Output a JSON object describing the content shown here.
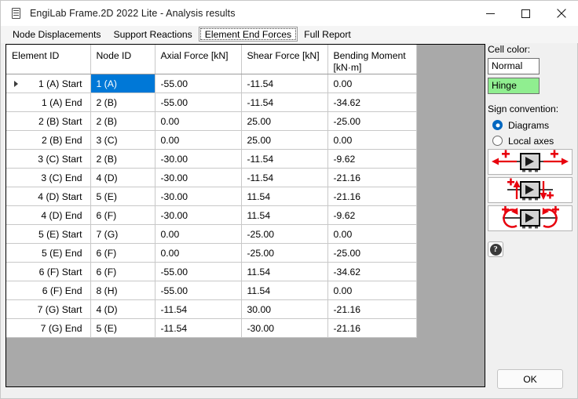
{
  "window": {
    "title": "EngiLab Frame.2D 2022 Lite - Analysis results",
    "icon": "document-icon",
    "controls": {
      "minimize": "minimize-icon",
      "maximize": "maximize-icon",
      "close": "close-icon"
    }
  },
  "tabs": [
    {
      "label": "Node Displacements",
      "selected": false
    },
    {
      "label": "Support Reactions",
      "selected": false
    },
    {
      "label": "Element End Forces",
      "selected": true
    },
    {
      "label": "Full Report",
      "selected": false
    }
  ],
  "table": {
    "columns": [
      "Element ID",
      "Node ID",
      "Axial Force [kN]",
      "Shear Force [kN]",
      "Bending Moment [kN·m]"
    ],
    "selected_cell": {
      "row": 0,
      "col": 1
    },
    "current_row_marker": 0,
    "rows": [
      {
        "element": "1 (A) Start",
        "node": "1 (A)",
        "axial": "-55.00",
        "shear": "-11.54",
        "moment": "0.00"
      },
      {
        "element": "1 (A) End",
        "node": "2 (B)",
        "axial": "-55.00",
        "shear": "-11.54",
        "moment": "-34.62"
      },
      {
        "element": "2 (B) Start",
        "node": "2 (B)",
        "axial": "0.00",
        "shear": "25.00",
        "moment": "-25.00"
      },
      {
        "element": "2 (B) End",
        "node": "3 (C)",
        "axial": "0.00",
        "shear": "25.00",
        "moment": "0.00"
      },
      {
        "element": "3 (C) Start",
        "node": "2 (B)",
        "axial": "-30.00",
        "shear": "-11.54",
        "moment": "-9.62"
      },
      {
        "element": "3 (C) End",
        "node": "4 (D)",
        "axial": "-30.00",
        "shear": "-11.54",
        "moment": "-21.16"
      },
      {
        "element": "4 (D) Start",
        "node": "5 (E)",
        "axial": "-30.00",
        "shear": "11.54",
        "moment": "-21.16"
      },
      {
        "element": "4 (D) End",
        "node": "6 (F)",
        "axial": "-30.00",
        "shear": "11.54",
        "moment": "-9.62"
      },
      {
        "element": "5 (E) Start",
        "node": "7 (G)",
        "axial": "0.00",
        "shear": "-25.00",
        "moment": "0.00"
      },
      {
        "element": "5 (E) End",
        "node": "6 (F)",
        "axial": "0.00",
        "shear": "-25.00",
        "moment": "-25.00"
      },
      {
        "element": "6 (F) Start",
        "node": "6 (F)",
        "axial": "-55.00",
        "shear": "11.54",
        "moment": "-34.62"
      },
      {
        "element": "6 (F) End",
        "node": "8 (H)",
        "axial": "-55.00",
        "shear": "11.54",
        "moment": "0.00"
      },
      {
        "element": "7 (G) Start",
        "node": "4 (D)",
        "axial": "-11.54",
        "shear": "30.00",
        "moment": "-21.16"
      },
      {
        "element": "7 (G) End",
        "node": "5 (E)",
        "axial": "-11.54",
        "shear": "-30.00",
        "moment": "-21.16"
      }
    ]
  },
  "panel": {
    "cell_color_label": "Cell color:",
    "cell_colors": [
      {
        "label": "Normal",
        "color": "#ffffff"
      },
      {
        "label": "Hinge",
        "color": "#90ee90"
      }
    ],
    "sign_convention_label": "Sign convention:",
    "sign_options": [
      {
        "label": "Diagrams",
        "selected": true
      },
      {
        "label": "Local axes",
        "selected": false
      }
    ],
    "diagrams": [
      {
        "name": "axial-force-sign-diagram"
      },
      {
        "name": "shear-force-sign-diagram"
      },
      {
        "name": "bending-moment-sign-diagram"
      }
    ],
    "help_label": "?",
    "accent_color": "#0078d7",
    "diagram_color": "#e8000d"
  },
  "footer": {
    "ok_label": "OK"
  }
}
